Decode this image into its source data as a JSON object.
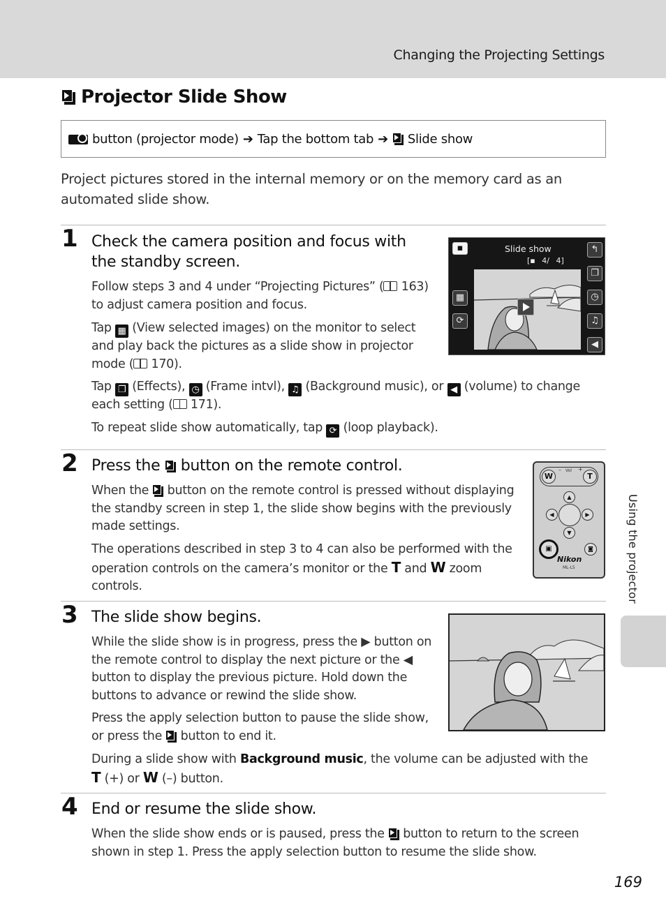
{
  "header": {
    "section_title": "Changing the Projecting Settings"
  },
  "page_title": "Projector Slide Show",
  "nav_path": {
    "start": "button (projector mode)",
    "step2": "Tap the bottom tab",
    "step3": "Slide show",
    "arrow": "➔"
  },
  "intro": "Project pictures stored in the internal memory or on the memory card as an automated slide show.",
  "steps": [
    {
      "number": "1",
      "title": "Check the camera position and focus with the standby screen.",
      "paragraphs": [
        "Follow steps 3 and 4 under “Projecting Pictures” (",
        "Tap",
        "Tap",
        "To repeat slide show automatically, tap"
      ],
      "p1_ref": "163)",
      "p1_tail": "to adjust camera position and focus.",
      "p2_tail": "(View selected images) on the monitor to select and play back the pictures as a slide show in projector mode (",
      "p2_ref": "170).",
      "p3_effects": "(Effects),",
      "p3_frame": "(Frame intvl),",
      "p3_music": "(Background music), or",
      "p3_volume": "(volume) to change each setting (",
      "p3_ref": "171).",
      "p4_tail": "(loop playback)."
    },
    {
      "number": "2",
      "title_pre": "Press the",
      "title_post": "button on the remote control.",
      "p1_pre": "When the",
      "p1_post": "button on the remote control is pressed without displaying the standby screen in step 1, the slide show begins with the previously made settings.",
      "p2_pre": "The operations described in step 3 to 4 can also be performed with the operation controls on the camera’s monitor or the",
      "p2_T": "T",
      "p2_and": "and",
      "p2_W": "W",
      "p2_post": "zoom controls."
    },
    {
      "number": "3",
      "title": "The slide show begins.",
      "p1_a": "While the slide show is in progress, press the",
      "p1_b": "button on the remote control to display the next picture or the",
      "p1_c": "button to display the previous picture. Hold down the buttons to advance or rewind the slide show.",
      "p2_a": "Press the apply selection button to pause the slide show, or press the",
      "p2_b": "button to end it.",
      "p3_a": "During a slide show with",
      "p3_bold": "Background music",
      "p3_b": ", the volume can be adjusted with the",
      "p3_T": "T",
      "p3_c": "(+) or",
      "p3_W": "W",
      "p3_d": "(–) button."
    },
    {
      "number": "4",
      "title": "End or resume the slide show.",
      "p1_a": "When the slide show ends or is paused, press the",
      "p1_b": "button to return to the screen shown in step 1. Press the apply selection button to resume the slide show."
    }
  ],
  "camera_screen": {
    "title": "Slide show",
    "counter": "[▪ 4/ 4]",
    "left_icons": [
      "projector-mode-icon",
      "view-selected-icon",
      "loop-playback-icon"
    ],
    "right_icons": [
      "back-icon",
      "effects-icon",
      "frame-interval-icon",
      "music-icon",
      "volume-icon"
    ]
  },
  "remote": {
    "w_label": "W",
    "t_label": "T",
    "vol_label": "Vol",
    "minus": "–",
    "plus": "+",
    "brand": "Nikon",
    "model": "ML-L5"
  },
  "side_tab": {
    "label": "Using the projector"
  },
  "page_number": "169"
}
